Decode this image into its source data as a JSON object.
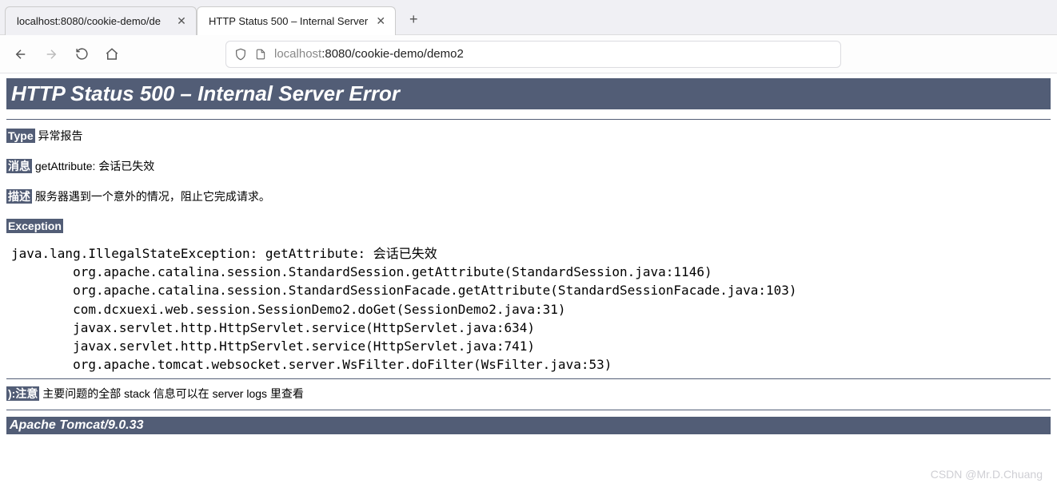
{
  "browser": {
    "tabs": [
      {
        "title": "localhost:8080/cookie-demo/de",
        "active": false
      },
      {
        "title": "HTTP Status 500 – Internal Server",
        "active": true
      }
    ],
    "url": {
      "host": "localhost",
      "port_path": ":8080/cookie-demo/demo2"
    }
  },
  "error": {
    "heading": "HTTP Status 500 – Internal Server Error",
    "type_label": "Type",
    "type_value": "异常报告",
    "message_label": "消息",
    "message_value": "getAttribute: 会话已失效",
    "description_label": "描述",
    "description_value": "服务器遇到一个意外的情况，阻止它完成请求。",
    "exception_label": "Exception",
    "stack": "java.lang.IllegalStateException: getAttribute: 会话已失效\n\torg.apache.catalina.session.StandardSession.getAttribute(StandardSession.java:1146)\n\torg.apache.catalina.session.StandardSessionFacade.getAttribute(StandardSessionFacade.java:103)\n\tcom.dcxuexi.web.session.SessionDemo2.doGet(SessionDemo2.java:31)\n\tjavax.servlet.http.HttpServlet.service(HttpServlet.java:634)\n\tjavax.servlet.http.HttpServlet.service(HttpServlet.java:741)\n\torg.apache.tomcat.websocket.server.WsFilter.doFilter(WsFilter.java:53)",
    "note_label": "):注意",
    "note_value": "主要问题的全部 stack 信息可以在 server logs 里查看",
    "server": "Apache Tomcat/9.0.33"
  },
  "watermark": "CSDN @Mr.D.Chuang"
}
